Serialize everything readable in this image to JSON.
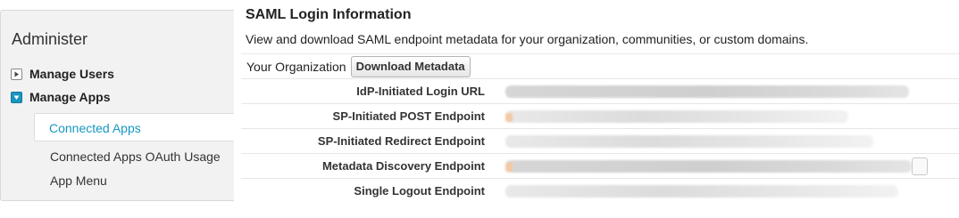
{
  "sidebar": {
    "title": "Administer",
    "items": [
      {
        "label": "Manage Users",
        "state": "collapsed"
      },
      {
        "label": "Manage Apps",
        "state": "expanded"
      }
    ],
    "sub_items": [
      {
        "label": "Connected Apps",
        "selected": true
      },
      {
        "label": "Connected Apps OAuth Usage",
        "selected": false
      },
      {
        "label": "App Menu",
        "selected": false
      }
    ]
  },
  "main": {
    "title": "SAML Login Information",
    "description": "View and download SAML endpoint metadata for your organization, communities, or custom domains.",
    "org_label": "Your Organization",
    "download_button": "Download Metadata",
    "fields": [
      {
        "label": "IdP-Initiated Login URL",
        "value": ""
      },
      {
        "label": "SP-Initiated POST Endpoint",
        "value": ""
      },
      {
        "label": "SP-Initiated Redirect Endpoint",
        "value": ""
      },
      {
        "label": "Metadata Discovery Endpoint",
        "value": ""
      },
      {
        "label": "Single Logout Endpoint",
        "value": ""
      }
    ]
  },
  "colors": {
    "accent": "#1797c0",
    "sidebar_bg": "#f2f2f2",
    "text": "#222222"
  },
  "icons": {
    "manage_users_toggle": "triangle-right-icon",
    "manage_apps_toggle": "triangle-down-icon"
  }
}
